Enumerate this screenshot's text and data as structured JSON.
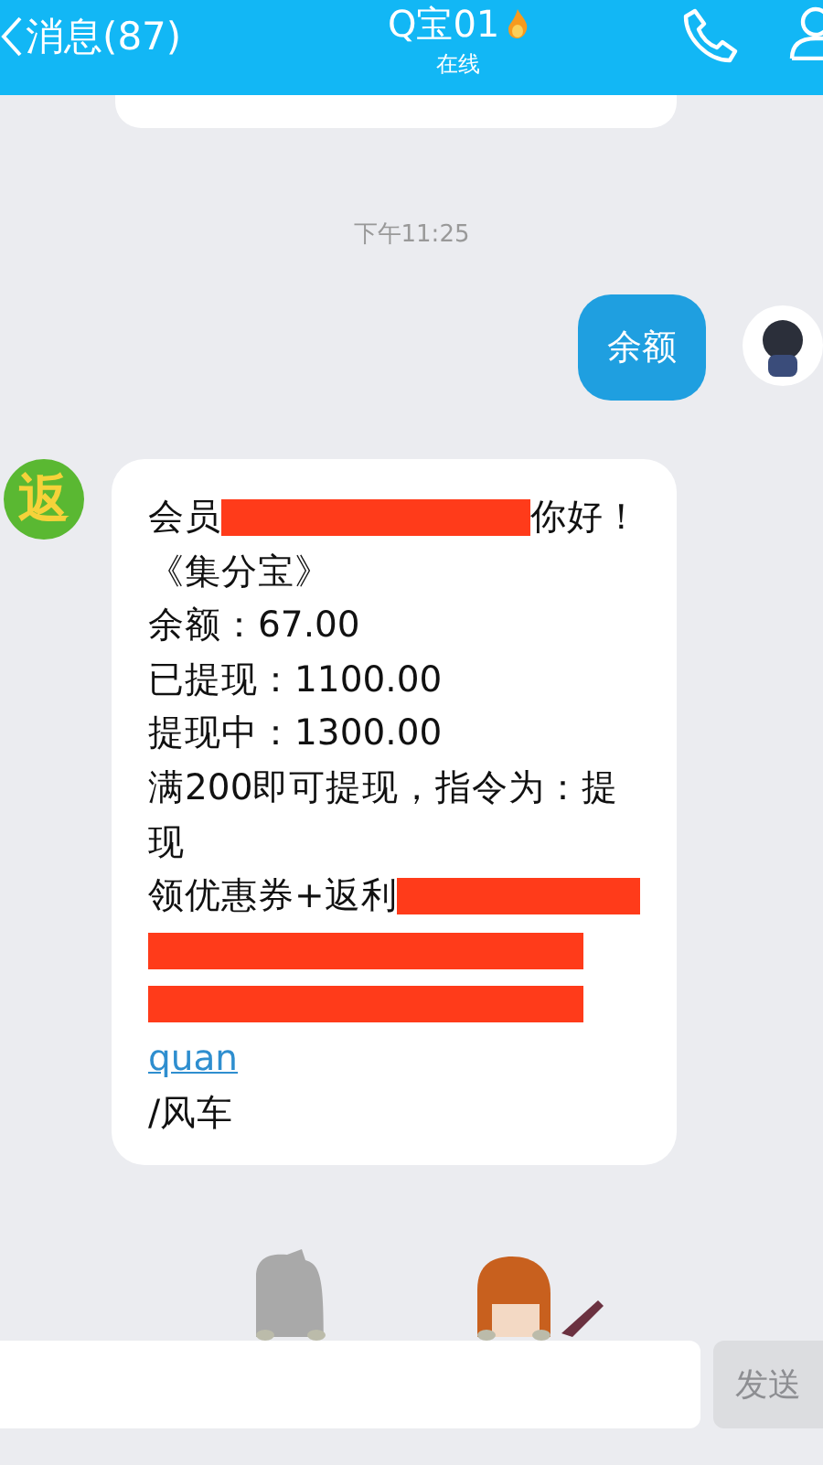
{
  "header": {
    "back_label": "消息(87)",
    "title": "Q宝01",
    "status": "在线"
  },
  "timestamp": "下午11:25",
  "outgoing": {
    "text": "余额"
  },
  "incoming": {
    "avatar_text": "返",
    "lines": [
      [
        {
          "kind": "text",
          "text": "会员"
        },
        {
          "kind": "redacted"
        },
        {
          "kind": "text",
          "text": "你好！"
        }
      ],
      [
        {
          "kind": "text",
          "text": "《集分宝》"
        }
      ],
      [
        {
          "kind": "text",
          "text": "余额：67.00"
        }
      ],
      [
        {
          "kind": "text",
          "text": "已提现：1100.00"
        }
      ],
      [
        {
          "kind": "text",
          "text": "提现中：1300.00"
        }
      ],
      [
        {
          "kind": "text",
          "text": "满200即可提现，指令为：提现"
        }
      ],
      [
        {
          "kind": "text",
          "text": "领优惠券+返利"
        },
        {
          "kind": "redacted"
        }
      ],
      [
        {
          "kind": "redacted"
        }
      ],
      [
        {
          "kind": "redacted"
        }
      ],
      [
        {
          "kind": "link",
          "text": "quan"
        }
      ],
      [
        {
          "kind": "text",
          "text": "/风车"
        }
      ]
    ]
  },
  "composer": {
    "send_label": "发送",
    "send_disabled": true
  }
}
